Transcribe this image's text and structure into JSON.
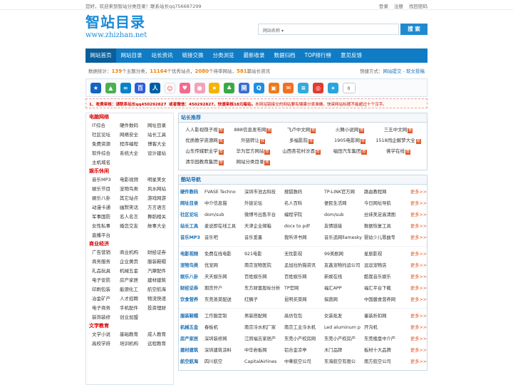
{
  "topbar": {
    "welcome": "您好，欢迎来到智站分类目录！联系站长qq756687299",
    "links": [
      "登录",
      "注册",
      "找回密码"
    ]
  },
  "logo": {
    "cn": "智站目录",
    "en": "www.zhizhan.net"
  },
  "search": {
    "select": "网站名称",
    "button": "搜 索"
  },
  "nav": [
    "网站首页",
    "网站目录",
    "站长资讯",
    "链接交换",
    "分类浏览",
    "最新收录",
    "数据归档",
    "TOP排行榜",
    "意见反馈"
  ],
  "stats": {
    "prefix": "数据统计：",
    "sites": "139",
    "sites_label": "个主题分类，",
    "approved": "11164",
    "approved_label": "个优秀站点，",
    "pending": "2080",
    "pending_label": "个待审网站，",
    "news": "581",
    "news_label": "篇站长资讯",
    "quick_label": "快捷方式：",
    "quick1": "网站提交",
    "sep": "-",
    "quick2": "软文投稿"
  },
  "icons": [
    {
      "name": "star-icon",
      "glyph": "★",
      "color": "#1565c0"
    },
    {
      "name": "photo-icon",
      "glyph": "▲",
      "color": "#4caf50"
    },
    {
      "name": "infinity-icon",
      "glyph": "∞",
      "color": "#0a82c8"
    },
    {
      "name": "baidu-icon",
      "glyph": "百",
      "color": "#2e5bd6"
    },
    {
      "name": "renren-icon",
      "glyph": "人",
      "color": "#005ea4"
    },
    {
      "name": "people-icon",
      "glyph": "☺",
      "color": "#ffffff"
    },
    {
      "name": "heart-icon",
      "glyph": "♥",
      "color": "#f36a8d"
    },
    {
      "name": "pink-icon",
      "glyph": "●",
      "color": "#f7a0b8"
    },
    {
      "name": "favorite-icon",
      "glyph": "★",
      "color": "#f4b400"
    },
    {
      "name": "leaf-icon",
      "glyph": "♣",
      "color": "#3aa845"
    },
    {
      "name": "kaixin-icon",
      "glyph": "開",
      "color": "#3b6fd1"
    },
    {
      "name": "tencent-icon",
      "glyph": "Q",
      "color": "#1d8ee4"
    },
    {
      "name": "box-icon",
      "glyph": "▣",
      "color": "#f07a1a"
    },
    {
      "name": "mail-icon",
      "glyph": "✉",
      "color": "#f37021"
    },
    {
      "name": "note-icon",
      "glyph": "≡",
      "color": "#33aadd"
    },
    {
      "name": "weibo-icon",
      "glyph": "◎",
      "color": "#e33b2e"
    },
    {
      "name": "plus-icon",
      "glyph": "+",
      "color": "#28a4e0"
    }
  ],
  "share_count": "0",
  "notice": {
    "p1": "1、收费审核：请联系站长qq450292827",
    "p2": "或者微信：450292827，快速审核18元每站。",
    "p3": "本网站链接交的网站要有健康分类准确，快审网站标题不能超过十个汉字。"
  },
  "left": [
    {
      "title": "电脑网络",
      "items": [
        "IT综合",
        "硬件数码",
        "网址目录",
        "社区论坛",
        "网络安全",
        "站长工具",
        "免费资源",
        "程序编程",
        "博客大全",
        "软件综合",
        "系统大全",
        "设计建站",
        "主机域名",
        "",
        ""
      ]
    },
    {
      "title": "娱乐休闲",
      "items": [
        "音乐MP3",
        "电影视频",
        "明星美女",
        "娱乐节目",
        "宠物鸟类",
        "风水网站",
        "娱乐八卦",
        "其它站点",
        "游戏网游",
        "动漫卡通",
        "幽默笑话",
        "方言语言",
        "军事国防",
        "名人名言",
        "舞蹈相关",
        "女性私事",
        "婚恋交友",
        "故事大全",
        "直播平台",
        "",
        ""
      ]
    },
    {
      "title": "商业经济",
      "items": [
        "广告营销",
        "商业机构",
        "财经证券",
        "商务服务",
        "企业黄页",
        "服装鞋帽",
        "礼品玩具",
        "机械五金",
        "汽摩配件",
        "电子安防",
        "房产家居",
        "建材建筑",
        "印刷包装",
        "能源化工",
        "航空航海",
        "冶金矿产",
        "人才招聘",
        "物流快递",
        "电子商务",
        "手机配件",
        "投资理财",
        "装饰装修",
        "创业加盟",
        ""
      ]
    },
    {
      "title": "文学教育",
      "items": [
        "文学小说",
        "基础教育",
        "成人教育",
        "高校学府",
        "培训机构",
        "远程教育"
      ]
    }
  ],
  "rec_title": "站长推荐",
  "rec": [
    "人人影视筷子视",
    "888信息发布网",
    "飞卢中文网",
    "火舞小说网",
    "三五中文网",
    "优质教学资源网",
    "外链转让",
    "多福影院",
    "1905电影网",
    "1518闯企解梦大全",
    "山东传媒职业学",
    "华为官方网站",
    "山西杏花村汾酒",
    "福田汽车集团",
    "佛学在线",
    "清华园教育集团",
    "网站分类目录",
    "",
    "",
    ""
  ],
  "cool_title": "酷站导航",
  "groups": [
    [
      [
        "硬件数码",
        "FVASE Techno",
        "深圳市池古科技",
        "搜狐数码",
        "TP-LINK官方网",
        "路由教程网",
        "更多>>"
      ],
      [
        "网址目录",
        "中介信息猫",
        "外链论坛",
        "名人百科",
        "便民生活网",
        "今日网址导航",
        "更多>>"
      ],
      [
        "社区论坛",
        "dom/sub",
        "微博号出售平台",
        "编程学院",
        "dom/sub",
        "丝袜美足高清图",
        "更多>>"
      ],
      [
        "站长工具",
        "麦说即在线工具",
        "天津企业邮箱",
        "docx to pdf",
        "友情链接",
        "数据恢复工具",
        "更多>>"
      ],
      [
        "音乐MP3",
        "音乐吧",
        "音乐爱墨",
        "我听评书网",
        "音乐追网llamesky",
        "婴幼少儿歌曲专",
        "更多>>"
      ]
    ],
    [
      [
        "电影视频",
        "免费在线电影",
        "921电影",
        "无忧影视",
        "99美剧网",
        "星辰影视",
        "更多>>"
      ],
      [
        "宠物鸟类",
        "优宠网",
        "南京宠物医院",
        "孟加拉豹猫资讯",
        "友鑫宠物托运公司",
        "逗逗宠物店",
        "更多>>"
      ],
      [
        "娱乐八卦",
        "天天娱乐网",
        "百姓娱乐网",
        "百姓娱乐网",
        "新娱在线",
        "酷我音乐娱乐",
        "更多>>"
      ],
      [
        "财经证券",
        "期货开户",
        "东方财富股标分析",
        "TP官网",
        "福汇APP",
        "福汇平台下载",
        "更多>>"
      ],
      [
        "饮食营养",
        "东莞蒸菜配送",
        "红鲷子",
        "昆明买菜网",
        "探蔬网",
        "中国膳食营养网",
        "更多>>"
      ]
    ],
    [
      [
        "服装鞋帽",
        "工作服定制",
        "男装搭配网",
        "高仿包包",
        "女装批发",
        "童装折扣网",
        "更多>>"
      ],
      [
        "机械五金",
        "春板机",
        "南京冷水机厂家",
        "南京工业冷水机",
        "Led aluminum p",
        "开沟机",
        "更多>>"
      ],
      [
        "房产家居",
        "深圳装修网",
        "江阴福吉家居产",
        "东莞小产权房网",
        "东莞小产权房产",
        "东莞楼盘中介产",
        "更多>>"
      ],
      [
        "建材建筑",
        "深圳建筑涂料",
        "中华岩板网",
        "铝合金凉亭",
        "木门品牌",
        "板材十大品牌",
        "更多>>"
      ],
      [
        "航空航海",
        "四川航空",
        "CapitalAirlines",
        "中華航空公司",
        "东海航空有限公",
        "南方航空公司",
        "更多>>"
      ]
    ]
  ]
}
